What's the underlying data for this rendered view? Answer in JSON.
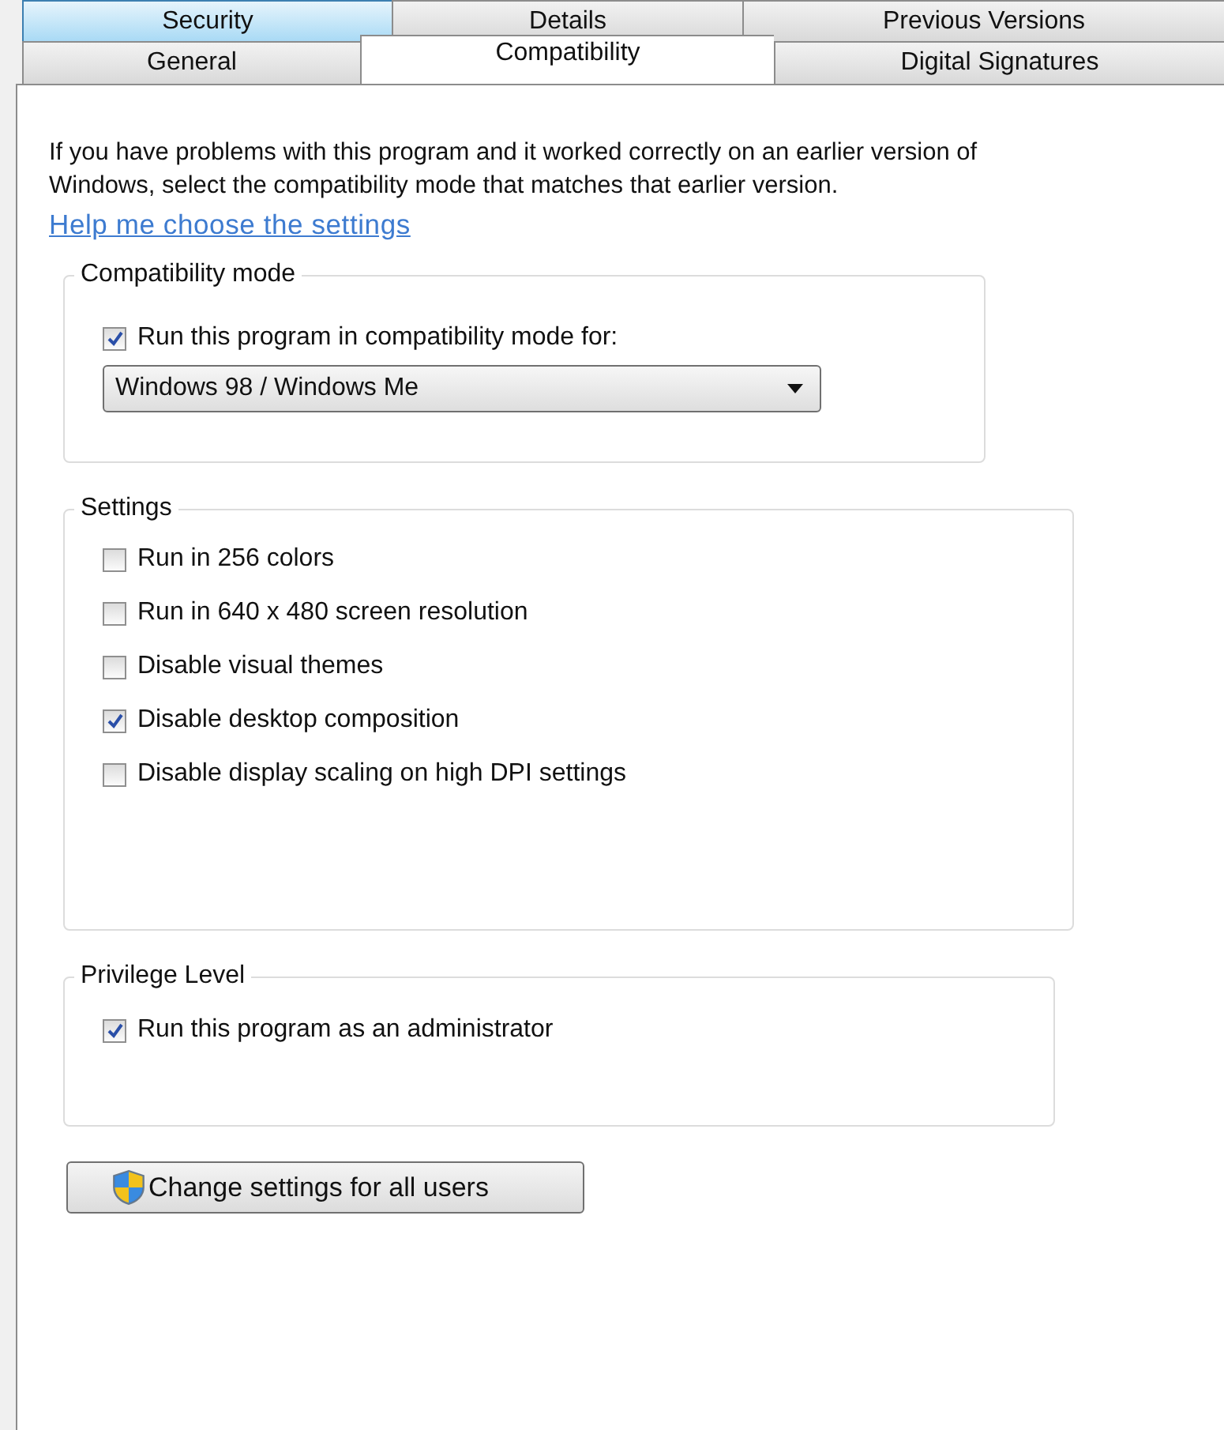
{
  "tab_rows": [
    [
      {
        "label": "Security",
        "selected": false,
        "hovered": true
      },
      {
        "label": "Details",
        "selected": false,
        "hovered": false
      },
      {
        "label": "Previous Versions",
        "selected": false,
        "hovered": false
      }
    ],
    [
      {
        "label": "General",
        "selected": false,
        "hovered": false
      },
      {
        "label": "Compatibility",
        "selected": true,
        "hovered": false
      },
      {
        "label": "Digital Signatures",
        "selected": false,
        "hovered": false
      }
    ]
  ],
  "intro": "If you have problems with this program and it worked correctly on an earlier version of Windows, select the compatibility mode that matches that earlier version.",
  "help_link": "Help me choose the settings",
  "groups": [
    {
      "title": "Compatibility mode",
      "items": [
        {
          "kind": "checkbox",
          "label": "Run this program in compatibility mode for:",
          "checked": true
        },
        {
          "kind": "dropdown",
          "value": "Windows 98 / Windows Me"
        }
      ]
    },
    {
      "title": "Settings",
      "items": [
        {
          "kind": "checkbox",
          "label": "Run in 256 colors",
          "checked": false
        },
        {
          "kind": "checkbox",
          "label": "Run in 640 x 480 screen resolution",
          "checked": false
        },
        {
          "kind": "checkbox",
          "label": "Disable visual themes",
          "checked": false
        },
        {
          "kind": "checkbox",
          "label": "Disable desktop composition",
          "checked": true
        },
        {
          "kind": "checkbox",
          "label": "Disable display scaling on high DPI settings",
          "checked": false
        }
      ]
    },
    {
      "title": "Privilege Level",
      "items": [
        {
          "kind": "checkbox",
          "label": "Run this program as an administrator",
          "checked": true
        }
      ]
    }
  ],
  "button": "Change settings for all users"
}
